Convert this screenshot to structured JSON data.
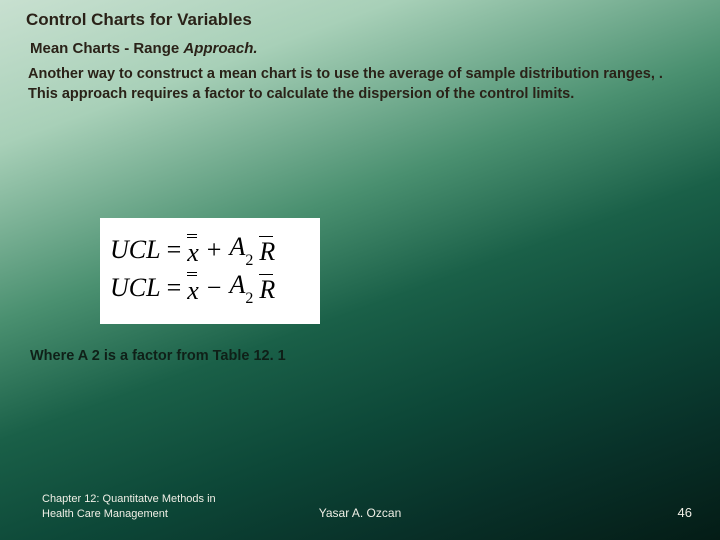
{
  "title": "Control Charts for Variables",
  "subtitle_plain": "Mean Charts - Range ",
  "subtitle_italic": "Approach.",
  "body": "Another way to construct a mean chart is to use the average of sample distribution ranges, .   This approach requires a factor to calculate the dispersion of the control limits.",
  "formula": {
    "ucl_label": "UCL",
    "lcl_label": "UCL",
    "eq": "=",
    "x": "x",
    "plus": "+",
    "minus": "−",
    "A": "A",
    "sub2": "2",
    "R": "R"
  },
  "where": "Where A 2 is a factor from Table 12. 1",
  "footer": {
    "left": "Chapter 12: Quantitatve Methods in Health Care Management",
    "center": "Yasar A. Ozcan",
    "right": "46"
  }
}
